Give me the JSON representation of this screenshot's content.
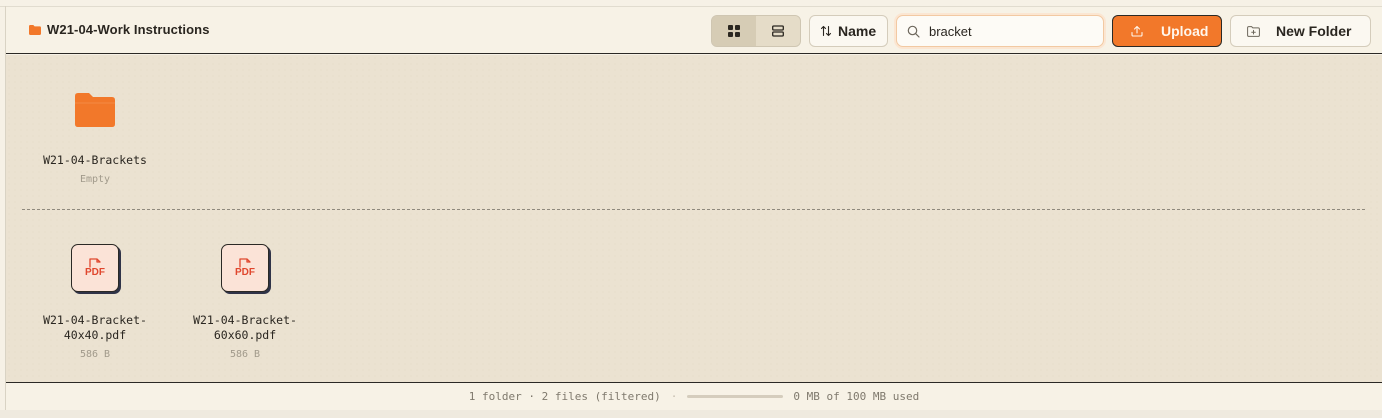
{
  "breadcrumb": {
    "current_folder": "W21-04-Work Instructions"
  },
  "toolbar": {
    "view_modes": [
      "grid",
      "list"
    ],
    "active_view": "grid",
    "sort_label": "Name",
    "search": {
      "value": "bracket",
      "placeholder": ""
    },
    "upload_label": "Upload",
    "new_folder_label": "New Folder"
  },
  "folders": [
    {
      "name": "W21-04-Brackets",
      "meta": "Empty"
    }
  ],
  "files": [
    {
      "type_label": "PDF",
      "name_line1": "W21-04-Bracket-",
      "name_line2": "40x40.pdf",
      "size": "586 B"
    },
    {
      "type_label": "PDF",
      "name_line1": "W21-04-Bracket-",
      "name_line2": "60x60.pdf",
      "size": "586 B"
    }
  ],
  "status": {
    "summary": "1 folder · 2 files (filtered)",
    "separator": "·",
    "usage_text": "0 MB of 100 MB used",
    "usage_fraction": 0
  },
  "colors": {
    "accent": "#f2782a",
    "pdf": "#e0472e"
  }
}
